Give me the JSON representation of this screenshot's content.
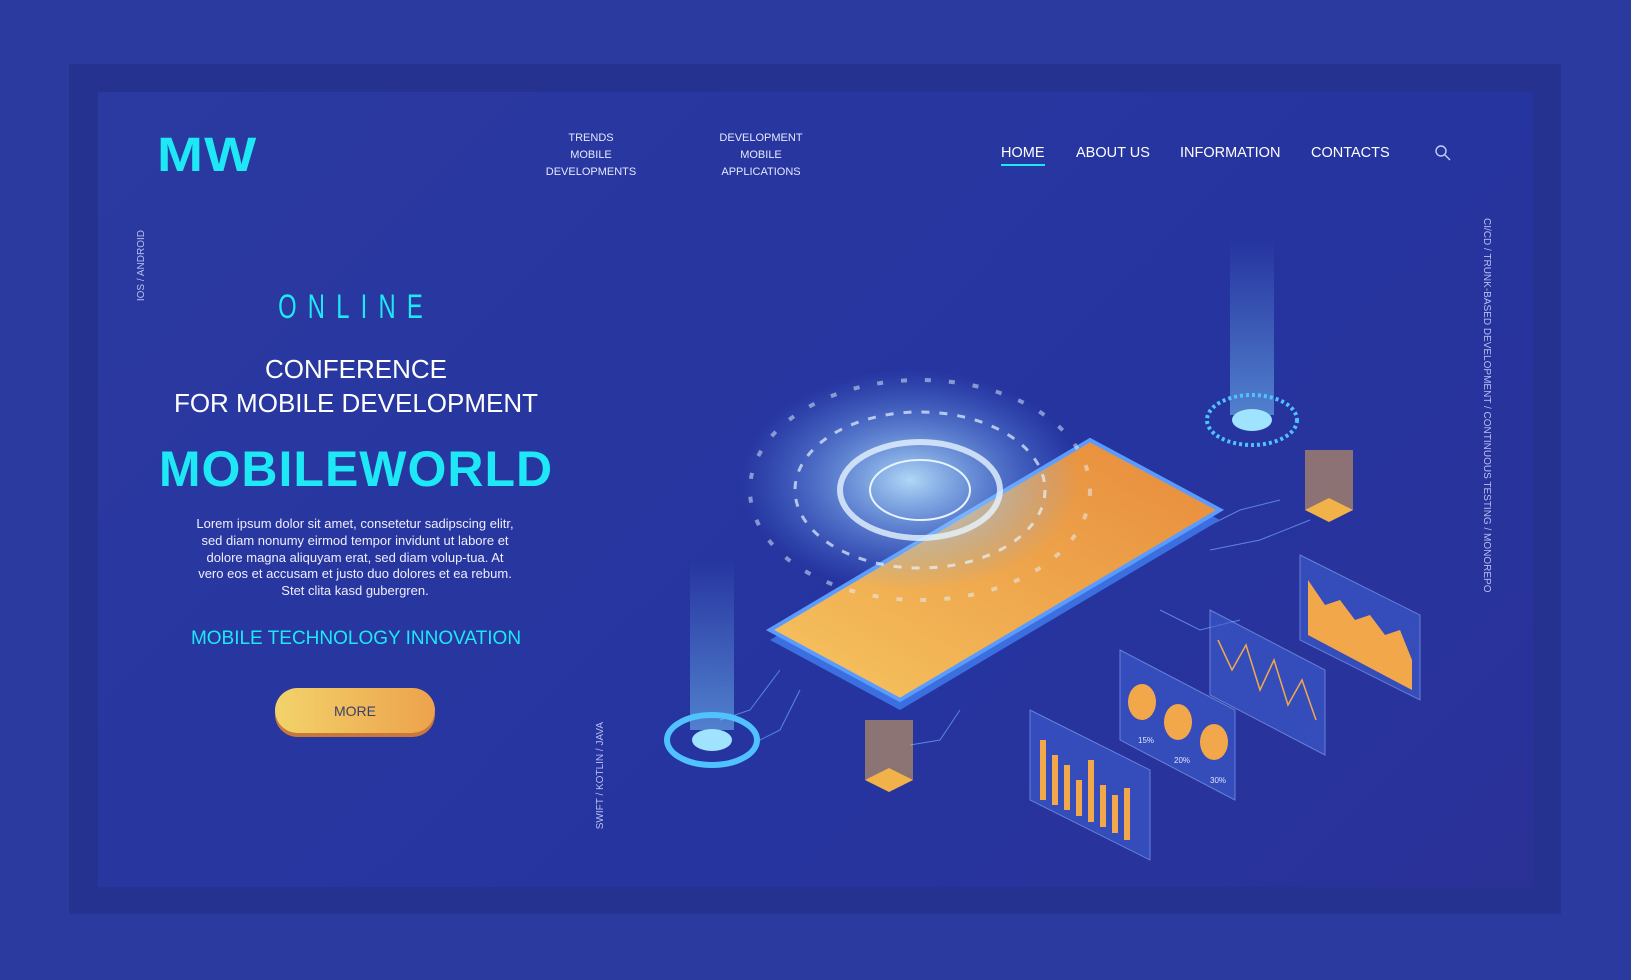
{
  "logo": "MW",
  "subnav": [
    [
      "TRENDS",
      "MOBILE",
      "DEVELOPMENTS"
    ],
    [
      "DEVELOPMENT",
      "MOBILE",
      "APPLICATIONS"
    ]
  ],
  "nav": {
    "items": [
      "HOME",
      "ABOUT US",
      "INFORMATION",
      "CONTACTS"
    ],
    "active": "HOME",
    "search_icon": "search-icon"
  },
  "side": {
    "left": "IOS / ANDROID",
    "middle": "SWIFT / KOTLIN / JAVA",
    "right": "CI/CD /  TRUNK-BASED DEVELOPMENT /  CONTINUOUS TESTING  /  MONOREPO"
  },
  "hero": {
    "eyebrow": "ONLINE",
    "line1": "CONFERENCE",
    "line2": "FOR MOBILE DEVELOPMENT",
    "title": "MOBILEWORLD",
    "body": "Lorem ipsum dolor sit amet, consetetur sadipscing elitr, sed diam nonumy eirmod tempor invidunt ut labore et dolore magna aliquyam erat, sed diam volup-tua. At vero eos et accusam et justo duo dolores et ea rebum. Stet clita kasd gubergren.",
    "tagline": "MOBILE TECHNOLOGY INNOVATION",
    "button": "MORE"
  },
  "illustration": {
    "pie_labels": [
      "15%",
      "20%",
      "30%"
    ]
  },
  "colors": {
    "background": "#2b3a9f",
    "accent": "#1ee8f5",
    "button": "#f2c35e",
    "phone": "#f0a848"
  }
}
